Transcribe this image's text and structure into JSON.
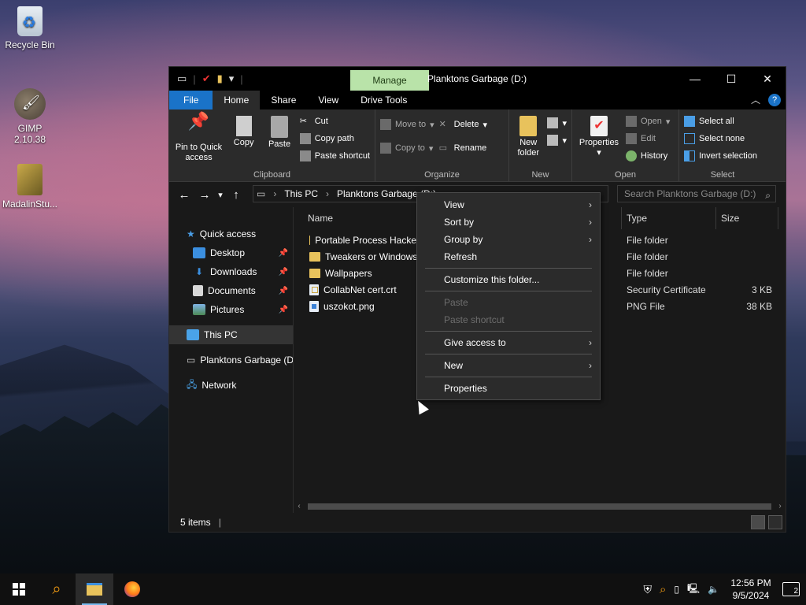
{
  "desktop": {
    "icons": [
      {
        "label": "Recycle Bin"
      },
      {
        "label": "GIMP 2.10.38"
      },
      {
        "label": "MadalinStu..."
      }
    ]
  },
  "window": {
    "title": "Planktons Garbage (D:)",
    "contextual_tab": "Manage",
    "tabs": [
      "File",
      "Home",
      "Share",
      "View",
      "Drive Tools"
    ],
    "active_tab": "Home",
    "controls": {
      "minimize": "—",
      "maximize": "☐",
      "close": "✕"
    }
  },
  "ribbon": {
    "clipboard": {
      "label": "Clipboard",
      "pin": "Pin to Quick access",
      "copy": "Copy",
      "paste": "Paste",
      "cut": "Cut",
      "copy_path": "Copy path",
      "paste_shortcut": "Paste shortcut"
    },
    "organize": {
      "label": "Organize",
      "move_to": "Move to",
      "copy_to": "Copy to",
      "delete": "Delete",
      "rename": "Rename"
    },
    "new": {
      "label": "New",
      "new_folder": "New folder"
    },
    "open": {
      "label": "Open",
      "properties": "Properties",
      "open": "Open",
      "edit": "Edit",
      "history": "History"
    },
    "select": {
      "label": "Select",
      "select_all": "Select all",
      "select_none": "Select none",
      "invert": "Invert selection"
    }
  },
  "address": {
    "crumbs": [
      "This PC",
      "Planktons Garbage (D:)"
    ],
    "search_placeholder": "Search Planktons Garbage (D:)"
  },
  "navpane": {
    "quick_access": "Quick access",
    "pinned": [
      "Desktop",
      "Downloads",
      "Documents",
      "Pictures"
    ],
    "this_pc": "This PC",
    "drive": "Planktons Garbage (D:)",
    "network": "Network"
  },
  "columns": {
    "name": "Name",
    "type": "Type",
    "size": "Size"
  },
  "files": [
    {
      "name": "Portable Process Hacker",
      "type": "File folder",
      "size": "",
      "kind": "folder"
    },
    {
      "name": "Tweakers or Windows",
      "type": "File folder",
      "size": "",
      "kind": "folder"
    },
    {
      "name": "Wallpapers",
      "type": "File folder",
      "size": "",
      "kind": "folder"
    },
    {
      "name": "CollabNet cert.crt",
      "type": "Security Certificate",
      "size": "3 KB",
      "kind": "cert"
    },
    {
      "name": "uszokot.png",
      "type": "PNG File",
      "size": "38 KB",
      "kind": "png"
    }
  ],
  "status": {
    "items": "5 items"
  },
  "context_menu": {
    "view": "View",
    "sort_by": "Sort by",
    "group_by": "Group by",
    "refresh": "Refresh",
    "customize": "Customize this folder...",
    "paste": "Paste",
    "paste_shortcut": "Paste shortcut",
    "give_access": "Give access to",
    "new": "New",
    "properties": "Properties"
  },
  "taskbar": {
    "clock_time": "12:56 PM",
    "clock_date": "9/5/2024",
    "notifications": "2"
  }
}
